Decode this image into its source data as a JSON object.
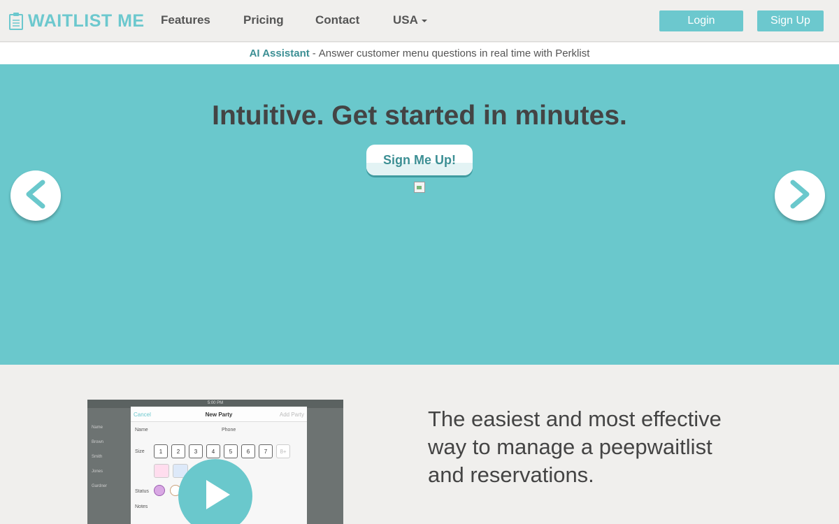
{
  "header": {
    "brand": "WAITLIST ME",
    "nav": {
      "features": "Features",
      "pricing": "Pricing",
      "contact": "Contact",
      "country": "USA"
    },
    "login_label": "Login",
    "signup_label": "Sign Up"
  },
  "announcement": {
    "link_text": "AI Assistant",
    "separator": "-",
    "text": "Answer customer menu questions in real time with Perklist"
  },
  "hero": {
    "title": "Intuitive. Get started in minutes.",
    "cta_label": "Sign Me Up!"
  },
  "video": {
    "time": "5:00 PM",
    "cancel": "Cancel",
    "title": "New Party",
    "add": "Add Party",
    "name_label": "Name",
    "phone_label": "Phone",
    "size_label": "Size",
    "status_label": "Status",
    "notes_label": "Notes",
    "sizes": [
      "1",
      "2",
      "3",
      "4",
      "5",
      "6",
      "7",
      "8+"
    ],
    "side_list": [
      "Name",
      "Brown",
      "Smith",
      "Jones",
      "Gardner"
    ]
  },
  "tagline": "The easiest and most effective way to manage a peepwaitlist and reservations.",
  "colors": {
    "accent": "#6cc8ce",
    "hero_bg": "#6ac8cc",
    "link": "#3c8f94"
  }
}
